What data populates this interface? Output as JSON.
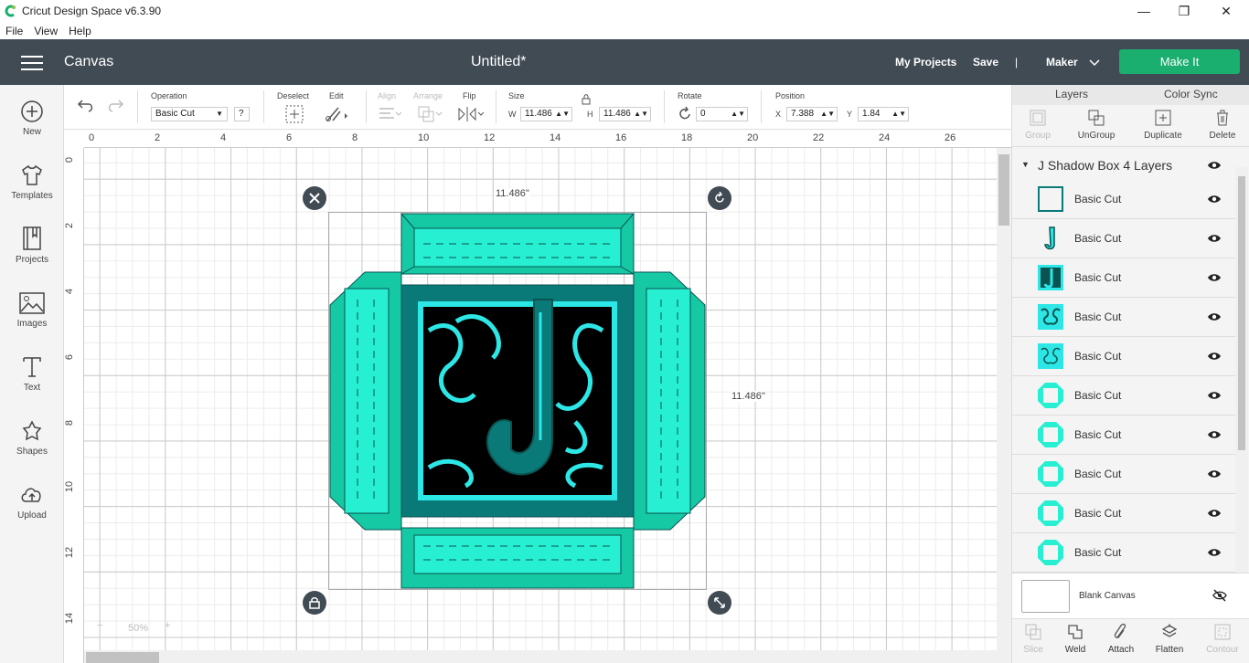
{
  "window": {
    "title": "Cricut Design Space  v6.3.90",
    "minimize": "—",
    "maximize": "❐",
    "close": "✕"
  },
  "menu": [
    "File",
    "View",
    "Help"
  ],
  "header": {
    "section": "Canvas",
    "doc_title": "Untitled*",
    "my_projects": "My Projects",
    "save": "Save",
    "divider": "|",
    "machine": "Maker",
    "make_it": "Make It"
  },
  "sidebar": [
    {
      "label": "New",
      "icon": "plus-circle-icon"
    },
    {
      "label": "Templates",
      "icon": "shirt-icon"
    },
    {
      "label": "Projects",
      "icon": "bookmark-icon"
    },
    {
      "label": "Images",
      "icon": "image-icon"
    },
    {
      "label": "Text",
      "icon": "text-t-icon"
    },
    {
      "label": "Shapes",
      "icon": "shapes-icon"
    },
    {
      "label": "Upload",
      "icon": "cloud-upload-icon"
    }
  ],
  "toolbar": {
    "operation_label": "Operation",
    "operation_value": "Basic Cut",
    "help": "?",
    "deselect_label": "Deselect",
    "edit_label": "Edit",
    "align_label": "Align",
    "arrange_label": "Arrange",
    "flip_label": "Flip",
    "size_label": "Size",
    "w_label": "W",
    "w_value": "11.486",
    "h_label": "H",
    "h_value": "11.486",
    "rotate_label": "Rotate",
    "rotate_value": "0",
    "position_label": "Position",
    "x_label": "X",
    "x_value": "7.388",
    "y_label": "Y",
    "y_value": "1.84"
  },
  "ruler": {
    "top": [
      "0",
      "2",
      "4",
      "6",
      "8",
      "10",
      "12",
      "14",
      "16",
      "18",
      "20",
      "22",
      "24",
      "26"
    ],
    "left": [
      "0",
      "2",
      "4",
      "6",
      "8",
      "10",
      "12",
      "14"
    ]
  },
  "selection": {
    "width_label": "11.486\"",
    "height_label": "11.486\""
  },
  "zoom": {
    "minus": "−",
    "value": "50%",
    "plus": "+"
  },
  "right_panel": {
    "tabs": [
      "Layers",
      "Color Sync"
    ],
    "tools": [
      {
        "label": "Group",
        "icon": "group-icon",
        "enabled": false
      },
      {
        "label": "UnGroup",
        "icon": "ungroup-icon",
        "enabled": true
      },
      {
        "label": "Duplicate",
        "icon": "duplicate-icon",
        "enabled": true
      },
      {
        "label": "Delete",
        "icon": "trash-icon",
        "enabled": true
      }
    ],
    "group_name": "J Shadow Box 4 Layers",
    "layers": [
      {
        "name": "Basic Cut",
        "thumb": "outline-square"
      },
      {
        "name": "Basic Cut",
        "thumb": "letter-j"
      },
      {
        "name": "Basic Cut",
        "thumb": "filigree-j"
      },
      {
        "name": "Basic Cut",
        "thumb": "filigree-square"
      },
      {
        "name": "Basic Cut",
        "thumb": "filigree-square"
      },
      {
        "name": "Basic Cut",
        "thumb": "octagon-frame"
      },
      {
        "name": "Basic Cut",
        "thumb": "octagon-frame"
      },
      {
        "name": "Basic Cut",
        "thumb": "octagon-frame"
      },
      {
        "name": "Basic Cut",
        "thumb": "octagon-frame"
      },
      {
        "name": "Basic Cut",
        "thumb": "octagon-frame"
      }
    ],
    "blank_canvas": "Blank Canvas",
    "bottom_tools": [
      {
        "label": "Slice",
        "icon": "slice-icon",
        "enabled": false
      },
      {
        "label": "Weld",
        "icon": "weld-icon",
        "enabled": true
      },
      {
        "label": "Attach",
        "icon": "attach-icon",
        "enabled": true
      },
      {
        "label": "Flatten",
        "icon": "flatten-icon",
        "enabled": true
      },
      {
        "label": "Contour",
        "icon": "contour-icon",
        "enabled": false
      }
    ]
  },
  "colors": {
    "header_bg": "#414b54",
    "make_it": "#1aae6f",
    "teal_dark": "#0a7a78",
    "teal": "#16c9a5",
    "teal_light": "#27f0d2",
    "aqua": "#2de6e6"
  }
}
